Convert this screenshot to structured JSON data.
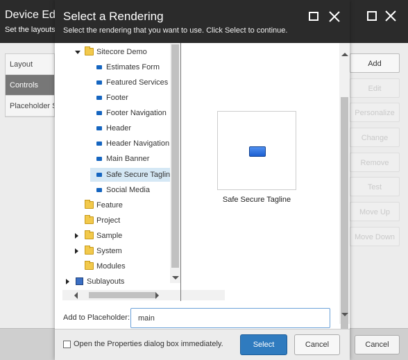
{
  "background": {
    "title": "Device Editor",
    "subtitle": "Set the layouts, controls and placeholders",
    "tabs": [
      {
        "label": "Layout"
      },
      {
        "label": "Controls"
      },
      {
        "label": "Placeholder Settings"
      }
    ],
    "buttons": [
      {
        "label": "Add",
        "enabled": true
      },
      {
        "label": "Edit",
        "enabled": false
      },
      {
        "label": "Personalize",
        "enabled": false
      },
      {
        "label": "Change",
        "enabled": false
      },
      {
        "label": "Remove",
        "enabled": false
      },
      {
        "label": "Test",
        "enabled": false
      },
      {
        "label": "Move Up",
        "enabled": false
      },
      {
        "label": "Move Down",
        "enabled": false
      }
    ],
    "cancel_label": "Cancel"
  },
  "dialog": {
    "title": "Select a Rendering",
    "subtitle": "Select the rendering that you want to use. Click Select to continue.",
    "tree": [
      {
        "label": "Sitecore Demo",
        "icon": "folder-icon",
        "expander": "down"
      },
      {
        "label": "Estimates Form",
        "icon": "rendering-icon"
      },
      {
        "label": "Featured Services",
        "icon": "rendering-icon"
      },
      {
        "label": "Footer",
        "icon": "rendering-icon"
      },
      {
        "label": "Footer Navigation",
        "icon": "rendering-icon"
      },
      {
        "label": "Header",
        "icon": "rendering-icon"
      },
      {
        "label": "Header Navigation",
        "icon": "rendering-icon"
      },
      {
        "label": "Main Banner",
        "icon": "rendering-icon"
      },
      {
        "label": "Safe Secure Tagline",
        "icon": "rendering-icon",
        "selected": true
      },
      {
        "label": "Social Media",
        "icon": "rendering-icon"
      },
      {
        "label": "Feature",
        "icon": "folder-icon"
      },
      {
        "label": "Project",
        "icon": "folder-icon"
      },
      {
        "label": "Sample",
        "icon": "folder-icon",
        "expander": "right"
      },
      {
        "label": "System",
        "icon": "folder-icon",
        "expander": "right"
      },
      {
        "label": "Modules",
        "icon": "folder-icon"
      },
      {
        "label": "Sublayouts",
        "icon": "sublayout-icon",
        "expander": "right"
      }
    ],
    "preview": {
      "label": "Safe Secure Tagline"
    },
    "placeholder": {
      "label": "Add to Placeholder:",
      "value": "main"
    },
    "open_properties_label": "Open the Properties dialog box immediately.",
    "open_properties_checked": false,
    "select_label": "Select",
    "cancel_label": "Cancel"
  },
  "colors": {
    "header_bg": "#2b2b2b",
    "primary_button": "#2f7bbf",
    "selection": "#d5e8f5"
  }
}
